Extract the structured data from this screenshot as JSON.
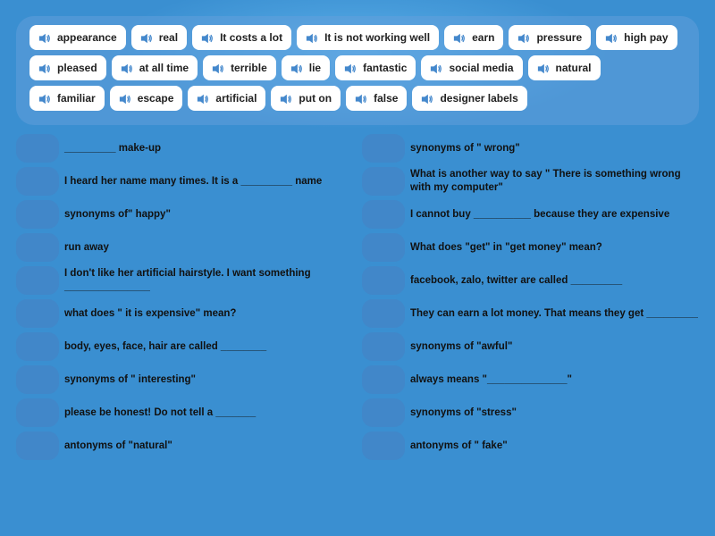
{
  "tiles": {
    "row1": [
      {
        "label": "appearance"
      },
      {
        "label": "real"
      },
      {
        "label": "It costs a lot"
      },
      {
        "label": "It is not working well"
      },
      {
        "label": "earn"
      },
      {
        "label": "pressure"
      },
      {
        "label": "high pay"
      }
    ],
    "row2": [
      {
        "label": "pleased"
      },
      {
        "label": "at all time"
      },
      {
        "label": "terrible"
      },
      {
        "label": "lie"
      },
      {
        "label": "fantastic"
      },
      {
        "label": "social media"
      },
      {
        "label": "natural"
      }
    ],
    "row3": [
      {
        "label": "familiar"
      },
      {
        "label": "escape"
      },
      {
        "label": "artificial"
      },
      {
        "label": "put on"
      },
      {
        "label": "false"
      },
      {
        "label": "designer labels"
      }
    ]
  },
  "questions": {
    "left": [
      {
        "text": "_________ make-up"
      },
      {
        "text": "I heard her name many times. It is a _________ name"
      },
      {
        "text": "synonyms of\" happy\""
      },
      {
        "text": "run away"
      },
      {
        "text": "I don't like her artificial hairstyle. I want something _______________"
      },
      {
        "text": "what does \" it is expensive\" mean?"
      },
      {
        "text": "body, eyes, face, hair are called ________"
      },
      {
        "text": "synonyms of \" interesting\""
      },
      {
        "text": "please be honest! Do not tell a _______"
      },
      {
        "text": "antonyms of \"natural\""
      }
    ],
    "right": [
      {
        "text": "synonyms of \" wrong\""
      },
      {
        "text": "What is another way to say \" There is something wrong with my computer\""
      },
      {
        "text": "I cannot buy __________ because they are expensive"
      },
      {
        "text": "What does \"get\" in \"get money\" mean?"
      },
      {
        "text": "facebook, zalo, twitter are called _________"
      },
      {
        "text": "They can earn a lot money. That means they get _________"
      },
      {
        "text": "synonyms of \"awful\""
      },
      {
        "text": "always means \"______________\""
      },
      {
        "text": "synonyms of \"stress\""
      },
      {
        "text": "antonyms of \" fake\""
      }
    ]
  }
}
